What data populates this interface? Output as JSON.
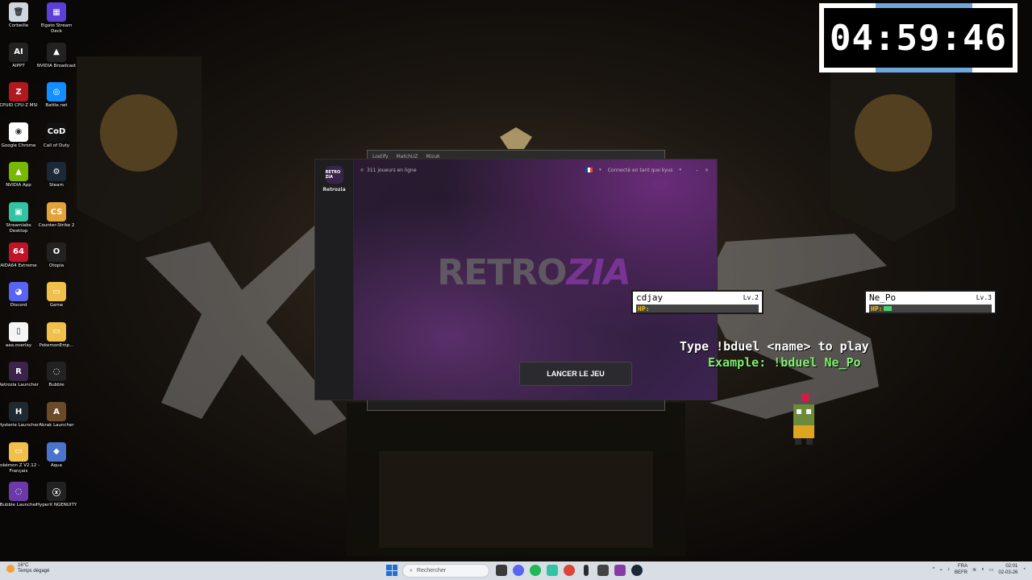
{
  "timer": {
    "value": "04:59:46"
  },
  "desktop_icons": [
    {
      "label": "Corbeille",
      "color": "#cfd6de",
      "glyph": "🗑"
    },
    {
      "label": "Elgato Stream Deck",
      "color": "#5b3fd6",
      "glyph": "▦"
    },
    {
      "label": "AIPPT",
      "color": "#222222",
      "glyph": "AI"
    },
    {
      "label": "NVIDIA Broadcast",
      "color": "#222222",
      "glyph": "▲"
    },
    {
      "label": "CPUID CPU-Z MSI",
      "color": "#b0191e",
      "glyph": "Z"
    },
    {
      "label": "Battle.net",
      "color": "#148eff",
      "glyph": "◎"
    },
    {
      "label": "Google Chrome",
      "color": "#ffffff",
      "glyph": "◉"
    },
    {
      "label": "Call of Duty",
      "color": "#111111",
      "glyph": "CoD"
    },
    {
      "label": "NVIDIA App",
      "color": "#76b900",
      "glyph": "▲"
    },
    {
      "label": "Steam",
      "color": "#1b2838",
      "glyph": "⚙"
    },
    {
      "label": "Streamlabs Desktop",
      "color": "#31c3a2",
      "glyph": "▣"
    },
    {
      "label": "Counter-Strike 2",
      "color": "#e3a23a",
      "glyph": "CS"
    },
    {
      "label": "AIDA64 Extreme",
      "color": "#c0142a",
      "glyph": "64"
    },
    {
      "label": "Otopia",
      "color": "#222222",
      "glyph": "O"
    },
    {
      "label": "Discord",
      "color": "#5865f2",
      "glyph": "◕"
    },
    {
      "label": "Game",
      "color": "#f1c04a",
      "glyph": "▭"
    },
    {
      "label": "aaa.overlay",
      "color": "#f5f5f5",
      "glyph": "▯"
    },
    {
      "label": "PokemonEmp...",
      "color": "#f1c04a",
      "glyph": "▭"
    },
    {
      "label": "Retrozia Launcher",
      "color": "#3b2449",
      "glyph": "R"
    },
    {
      "label": "Bubble",
      "color": "#222222",
      "glyph": "◌"
    },
    {
      "label": "Hysterie Launcher",
      "color": "#1f2a30",
      "glyph": "H"
    },
    {
      "label": "Abrak Launcher",
      "color": "#6b4a2a",
      "glyph": "A"
    },
    {
      "label": "Pokémon Z V2.12 - Français",
      "color": "#f1c04a",
      "glyph": "▭"
    },
    {
      "label": "Aqua",
      "color": "#4a74c9",
      "glyph": "◆"
    },
    {
      "label": "Bubble Launcher",
      "color": "#6a3aa8",
      "glyph": "◌"
    },
    {
      "label": "HyperX NGENUITY",
      "color": "#222222",
      "glyph": "ⓧ"
    }
  ],
  "ghost_window": {
    "tabs": [
      "Lostify",
      "MatchUZ",
      "Mizuk"
    ]
  },
  "launcher": {
    "sidebar_label": "Retrozia",
    "logo_small": "RETRO ZIA",
    "online": "311 joueurs en ligne",
    "connected": "Connecté en tant que kyus",
    "logo_retro": "RETRO",
    "logo_zia": "ZIA",
    "launch_label": "LANCER LE JEU"
  },
  "overlay": {
    "player1": {
      "name": "cdjay",
      "level": "Lv.2",
      "hp_label": "HP:",
      "hp_fraction": 0.0
    },
    "player2": {
      "name": "Ne_Po",
      "level": "Lv.3",
      "hp_label": "HP:",
      "hp_fraction": 0.08
    },
    "type_text": "Type !bduel <name> to play",
    "example_text": "Example: !bduel Ne_Po"
  },
  "taskbar": {
    "weather_temp": "16°C",
    "weather_desc": "Temps dégagé",
    "search_placeholder": "Rechercher",
    "lang": "FRA",
    "lang2": "BEFR",
    "time": "02:01",
    "date": "02-03-26"
  }
}
